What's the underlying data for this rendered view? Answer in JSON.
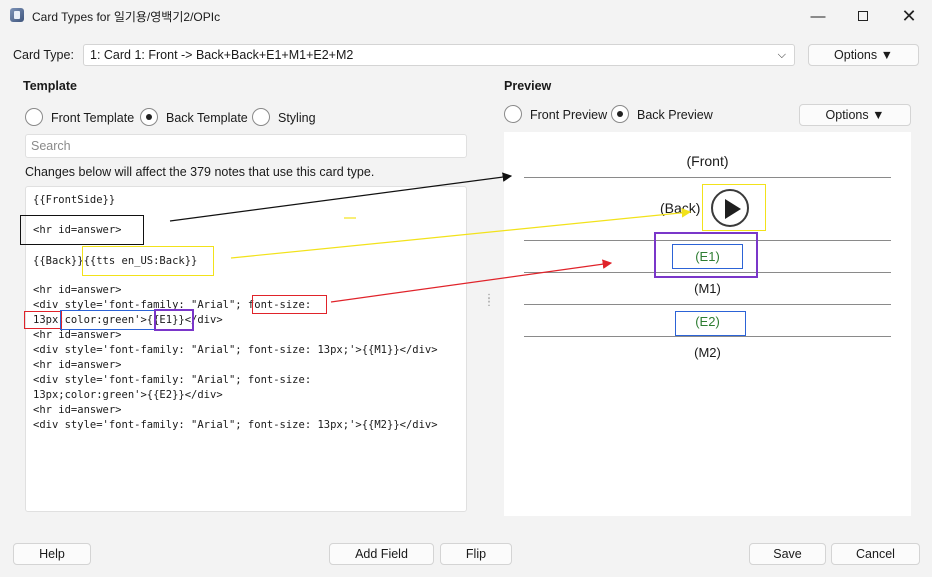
{
  "window": {
    "title": "Card Types for 일기용/영백기2/OPIc"
  },
  "card_type": {
    "label": "Card Type:",
    "selected": "1: Card 1: Front -> Back+Back+E1+M1+E2+M2",
    "options_label": "Options ▼"
  },
  "template": {
    "title": "Template",
    "radios": [
      {
        "label": "Front Template",
        "checked": false
      },
      {
        "label": "Back Template",
        "checked": true
      },
      {
        "label": "Styling",
        "checked": false
      }
    ],
    "search_placeholder": "Search",
    "changes_note": "Changes below will affect the 379 notes that use this card type.",
    "code_lines": [
      "{{FrontSide}}",
      "",
      "<hr id=answer>",
      "",
      "{{Back}}{{tts en_US:Back}}",
      "",
      "<hr id=answer>",
      "<div style='font-family: \"Arial\"; font-size:",
      "13px;color:green'>{{E1}}</div>",
      "<hr id=answer>",
      "<div style='font-family: \"Arial\"; font-size: 13px;'>{{M1}}</div>",
      "<hr id=answer>",
      "<div style='font-family: \"Arial\"; font-size:",
      "13px;color:green'>{{E2}}</div>",
      "<hr id=answer>",
      "<div style='font-family: \"Arial\"; font-size: 13px;'>{{M2}}</div>"
    ]
  },
  "preview": {
    "title": "Preview",
    "radios": [
      {
        "label": "Front Preview",
        "checked": false
      },
      {
        "label": "Back Preview",
        "checked": true
      }
    ],
    "options_label": "Options ▼",
    "front_text": "(Front)",
    "back_text": "(Back)",
    "e1_text": "(E1)",
    "m1_text": "(M1)",
    "e2_text": "(E2)",
    "m2_text": "(M2)",
    "e_color": "#2e7d32"
  },
  "buttons": {
    "help": "Help",
    "add_field": "Add Field",
    "flip": "Flip",
    "save": "Save",
    "cancel": "Cancel"
  },
  "annotation_colors": {
    "black": "#111111",
    "yellow": "#f2e21a",
    "red": "#e0232a",
    "blue": "#2c63d6",
    "purple": "#7a36c9"
  }
}
